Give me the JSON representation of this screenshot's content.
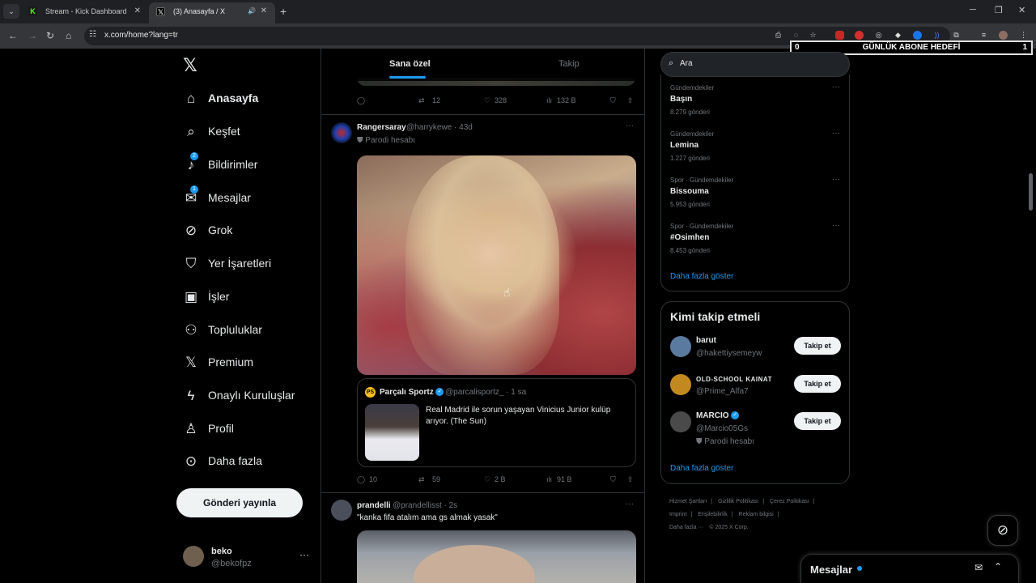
{
  "browser": {
    "tabs": [
      {
        "title": "Stream - Kick Dashboard",
        "icon": "kick-icon"
      },
      {
        "title": "(3) Anasayfa / X",
        "icon": "x-icon"
      }
    ],
    "url": "x.com/home?lang=tr"
  },
  "overlay": {
    "left": "0",
    "title": "GÜNLÜK ABONE HEDEFİ",
    "right": "1"
  },
  "nav": {
    "items": [
      {
        "label": "Anasayfa",
        "icon": "home-icon"
      },
      {
        "label": "Keşfet",
        "icon": "search-icon"
      },
      {
        "label": "Bildirimler",
        "icon": "bell-icon",
        "badge": "2"
      },
      {
        "label": "Mesajlar",
        "icon": "mail-icon",
        "badge": "1"
      },
      {
        "label": "Grok",
        "icon": "grok-icon"
      },
      {
        "label": "Yer İşaretleri",
        "icon": "bookmark-icon"
      },
      {
        "label": "İşler",
        "icon": "briefcase-icon"
      },
      {
        "label": "Topluluklar",
        "icon": "people-icon"
      },
      {
        "label": "Premium",
        "icon": "x-icon"
      },
      {
        "label": "Onaylı Kuruluşlar",
        "icon": "lightning-icon"
      },
      {
        "label": "Profil",
        "icon": "person-icon"
      },
      {
        "label": "Daha fazla",
        "icon": "more-circle-icon"
      }
    ],
    "post_button": "Gönderi yayınla",
    "account": {
      "name": "beko",
      "handle": "@bekofpz"
    }
  },
  "feed": {
    "tabs": [
      "Sana özel",
      "Takip"
    ],
    "prev_actions": {
      "retweets": "12",
      "likes": "328",
      "views": "132 B"
    },
    "post1": {
      "name": "Rangersaray",
      "handle": "@harrykewe · 43d",
      "parody": "Parodi hesabı",
      "quote": {
        "name": "Parçalı Sportz",
        "handle": "@parcalisportz_ · 1 sa",
        "text": "Real Madrid ile sorun yaşayan Vinicius Junior kulüp arıyor. (The Sun)"
      },
      "actions": {
        "replies": "10",
        "retweets": "59",
        "likes": "2 B",
        "views": "91 B"
      }
    },
    "post2": {
      "name": "prandelli",
      "handle": "@prandellisst · 2s",
      "text": "\"kanka fifa atalım ama gs almak yasak\""
    }
  },
  "right": {
    "search_placeholder": "Ara",
    "trends": [
      {
        "context": "Gündemdekiler",
        "name": "Başın",
        "count": "8.279 gönderi"
      },
      {
        "context": "Gündemdekiler",
        "name": "Lemina",
        "count": "1.227 gönderi"
      },
      {
        "context": "Spor · Gündemdekiler",
        "name": "Bissouma",
        "count": "5.953 gönderi"
      },
      {
        "context": "Spor · Gündemdekiler",
        "name": "#Osimhen",
        "count": "8.453 gönderi"
      }
    ],
    "trends_more": "Daha fazla göster",
    "follow_title": "Kimi takip etmeli",
    "follow": [
      {
        "name": "barut",
        "handle": "@hakettiysemeyw",
        "button": "Takip et"
      },
      {
        "name": "OLD-SCHOOL KAINAT",
        "handle": "@Prime_Alfa7",
        "button": "Takip et"
      },
      {
        "name": "MARCIO",
        "handle": "@Marcio05Gs",
        "parody": "Parodi hesabı",
        "button": "Takip et"
      }
    ],
    "follow_more": "Daha fazla göster",
    "footer": [
      "Hizmet Şartları",
      "Gizlilik Politikası",
      "Çerez Politikası",
      "Imprint",
      "Erişilebilirlik",
      "Reklam bilgisi",
      "Daha fazla ···",
      "© 2025 X Corp."
    ]
  },
  "messages_drawer": {
    "title": "Mesajlar"
  }
}
